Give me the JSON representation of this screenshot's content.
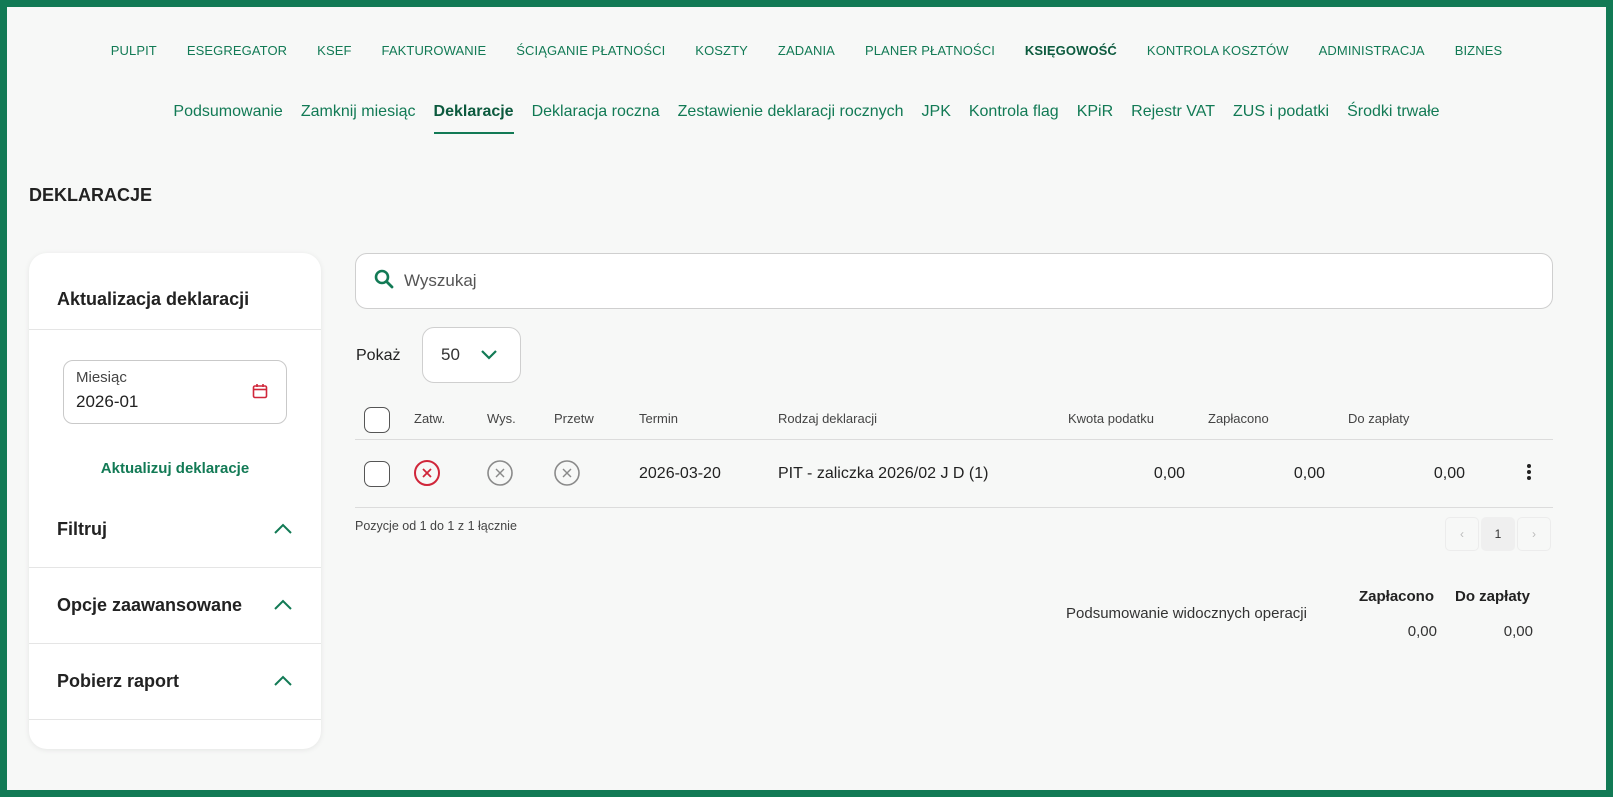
{
  "topnav": [
    "PULPIT",
    "ESEGREGATOR",
    "KSEF",
    "FAKTUROWANIE",
    "ŚCIĄGANIE PŁATNOŚCI",
    "KOSZTY",
    "ZADANIA",
    "PLANER PŁATNOŚCI",
    "KSIĘGOWOŚĆ",
    "KONTROLA KOSZTÓW",
    "ADMINISTRACJA",
    "BIZNES"
  ],
  "subnav": [
    "Podsumowanie",
    "Zamknij miesiąc",
    "Deklaracje",
    "Deklaracja roczna",
    "Zestawienie deklaracji rocznych",
    "JPK",
    "Kontrola flag",
    "KPiR",
    "Rejestr VAT",
    "ZUS i podatki",
    "Środki trwałe"
  ],
  "page_title": "DEKLARACJE",
  "left_panel": {
    "title": "Aktualizacja deklaracji",
    "month_label": "Miesiąc",
    "month_value": "2026-01",
    "update_link": "Aktualizuj deklaracje",
    "sections": [
      "Filtruj",
      "Opcje zaawansowane",
      "Pobierz raport"
    ]
  },
  "search": {
    "placeholder": "Wyszukaj"
  },
  "show": {
    "label": "Pokaż",
    "value": "50"
  },
  "table": {
    "headers": [
      "Zatw.",
      "Wys.",
      "Przetw",
      "Termin",
      "Rodzaj deklaracji",
      "Kwota podatku",
      "Zapłacono",
      "Do zapłaty"
    ],
    "rows": [
      {
        "termin": "2026-03-20",
        "rodzaj": "PIT - zaliczka 2026/02 J D (1)",
        "kwota": "0,00",
        "zaplacono": "0,00",
        "do_zaplaty": "0,00"
      }
    ]
  },
  "pagination": {
    "info": "Pozycje od 1 do 1 z 1 łącznie",
    "current_page": "1",
    "prev": "‹",
    "next": "›"
  },
  "summary": {
    "label": "Podsumowanie widocznych operacji",
    "col1": "Zapłacono",
    "col2": "Do zapłaty",
    "val1": "0,00",
    "val2": "0,00"
  },
  "colors": {
    "brand": "#127a55",
    "error": "#d0263a",
    "muted": "#8a8a8a"
  }
}
